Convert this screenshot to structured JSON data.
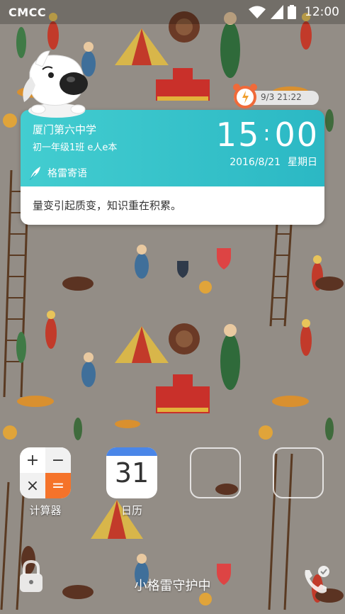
{
  "status_bar": {
    "carrier": "CMCC",
    "time": "12:00",
    "icons": [
      "wifi-icon",
      "signal-icon",
      "battery-icon"
    ]
  },
  "alarm": {
    "text": "9/3 21:22",
    "icon": "alarm-clock-icon"
  },
  "widget": {
    "school": "厦门第六中学",
    "class_name": "初一年级1班  e人e本",
    "time_hours": "15",
    "time_sep": ":",
    "time_minutes": "00",
    "date": "2016/8/21",
    "weekday": "星期日",
    "motto_title": "格雷寄语",
    "quote": "量变引起质变，知识重在积累。",
    "colors": {
      "top_start": "#43cdd0",
      "top_end": "#2bb8c4"
    }
  },
  "apps": [
    {
      "label": "计算器",
      "icon": "calculator-icon"
    },
    {
      "label": "日历",
      "icon": "calendar-icon",
      "day": "31"
    }
  ],
  "calculator_keys": [
    "+",
    "−",
    "×",
    "="
  ],
  "bottom": {
    "guard_text": "小格雷守护中",
    "lock_icon": "lock-icon",
    "phone_icon": "phone-icon"
  }
}
